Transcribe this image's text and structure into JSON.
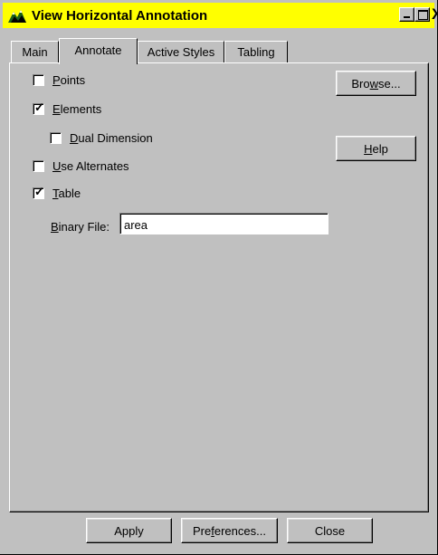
{
  "window": {
    "title": "View Horizontal Annotation",
    "title_bar_color": "#ffff00",
    "icon": "app-mountain-icon",
    "controls": {
      "minimize": "minimize-icon",
      "maximize": "maximize-icon",
      "close": "X"
    }
  },
  "tabs": [
    {
      "label": "Main",
      "active": false
    },
    {
      "label": "Annotate",
      "active": true
    },
    {
      "label": "Active Styles",
      "active": false
    },
    {
      "label": "Tabling",
      "active": false
    }
  ],
  "options": {
    "points": {
      "mnemonic": "P",
      "rest": "oints",
      "checked": false
    },
    "elements": {
      "mnemonic": "E",
      "rest": "lements",
      "checked": true
    },
    "dual_dimension": {
      "mnemonic": "D",
      "rest": "ual Dimension",
      "checked": false
    },
    "use_alternates": {
      "mnemonic": "U",
      "rest": "se Alternates",
      "checked": false
    },
    "table": {
      "mnemonic": "T",
      "rest": "able",
      "checked": true
    }
  },
  "binary_file": {
    "mnemonic": "B",
    "rest": "inary File:",
    "value": "area"
  },
  "side_buttons": {
    "browse": {
      "pre": "Bro",
      "mnemonic": "w",
      "post": "se..."
    },
    "help": {
      "pre": "",
      "mnemonic": "H",
      "post": "elp"
    }
  },
  "footer": {
    "apply": "Apply",
    "preferences": {
      "pre": "Pre",
      "mnemonic": "f",
      "post": "erences..."
    },
    "close": "Close"
  },
  "check_glyph": "✓"
}
